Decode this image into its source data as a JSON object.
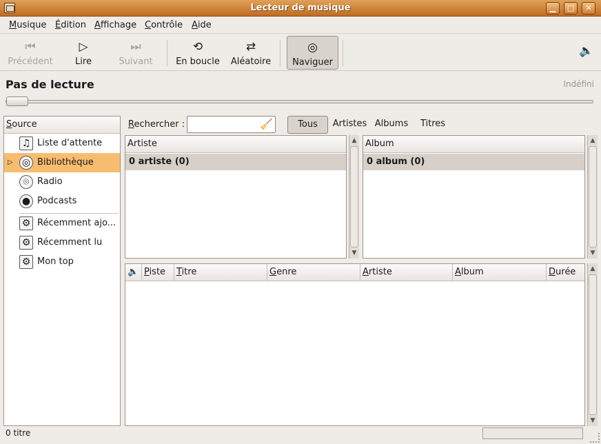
{
  "window": {
    "title": "Lecteur de musique",
    "buttons": {
      "minimize": "▁",
      "maximize": "□",
      "close": "✕"
    }
  },
  "menubar": [
    "Musique",
    "Édition",
    "Affichage",
    "Contrôle",
    "Aide"
  ],
  "toolbar": {
    "previous": "Précédent",
    "play": "Lire",
    "next": "Suivant",
    "repeat": "En boucle",
    "shuffle": "Aléatoire",
    "browse": "Naviguer"
  },
  "player": {
    "status": "Pas de lecture",
    "duration": "Indéfini",
    "progress": 0
  },
  "sources": {
    "header": "Source",
    "items": [
      {
        "label": "Liste d'attente",
        "icon": "playlist-icon"
      },
      {
        "label": "Bibliothèque",
        "icon": "library-icon",
        "selected": true
      },
      {
        "label": "Radio",
        "icon": "radio-icon"
      },
      {
        "label": "Podcasts",
        "icon": "podcast-icon"
      },
      {
        "label": "Récemment ajo...",
        "icon": "smart-playlist-icon"
      },
      {
        "label": "Récemment lu",
        "icon": "smart-playlist-icon"
      },
      {
        "label": "Mon top",
        "icon": "smart-playlist-icon"
      }
    ]
  },
  "search": {
    "label": "Rechercher :",
    "value": "",
    "placeholder": ""
  },
  "filters": [
    "Tous",
    "Artistes",
    "Albums",
    "Titres"
  ],
  "artistPane": {
    "header": "Artiste",
    "row": "0 artiste (0)"
  },
  "albumPane": {
    "header": "Album",
    "row": "0 album (0)"
  },
  "tracks": {
    "columns": [
      "Piste",
      "Titre",
      "Genre",
      "Artiste",
      "Album",
      "Durée"
    ]
  },
  "statusbar": {
    "text": "0 titre"
  },
  "colors": {
    "selection": "#f7bd6e",
    "titlebar": "#c06d22"
  }
}
